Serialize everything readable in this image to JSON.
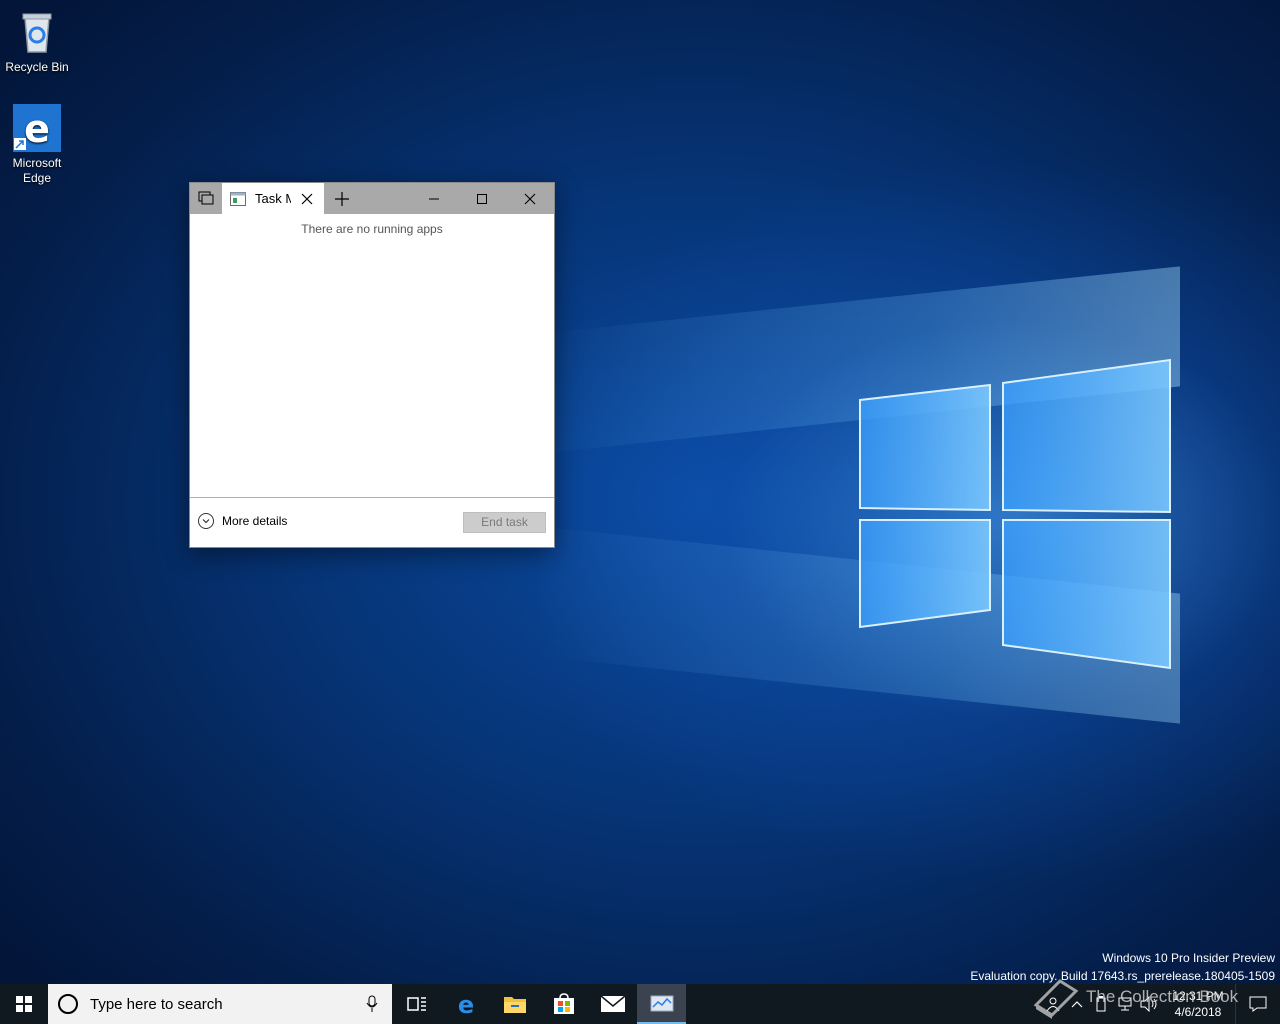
{
  "desktop": {
    "icons": [
      {
        "label": "Recycle Bin",
        "icon": "recycle-bin-icon"
      },
      {
        "label": "Microsoft Edge",
        "icon": "edge-icon"
      }
    ]
  },
  "window": {
    "tab_title": "Task M",
    "empty_message": "There are no running apps",
    "more_details_label": "More details",
    "end_task_label": "End task",
    "titlebar_color": "#a9a9a9"
  },
  "watermark": {
    "line1": "Windows 10 Pro Insider Preview",
    "line2": "Evaluation copy. Build 17643.rs_prerelease.180405-1509"
  },
  "taskbar": {
    "search_placeholder": "Type here to search",
    "apps": [
      "task-view-icon",
      "edge-icon",
      "file-explorer-icon",
      "store-icon",
      "mail-icon",
      "task-manager-icon"
    ],
    "overlay_text": "The Collection Book",
    "time": "12:31 PM",
    "date": "4/6/2018",
    "accent": "#76b9ed"
  }
}
